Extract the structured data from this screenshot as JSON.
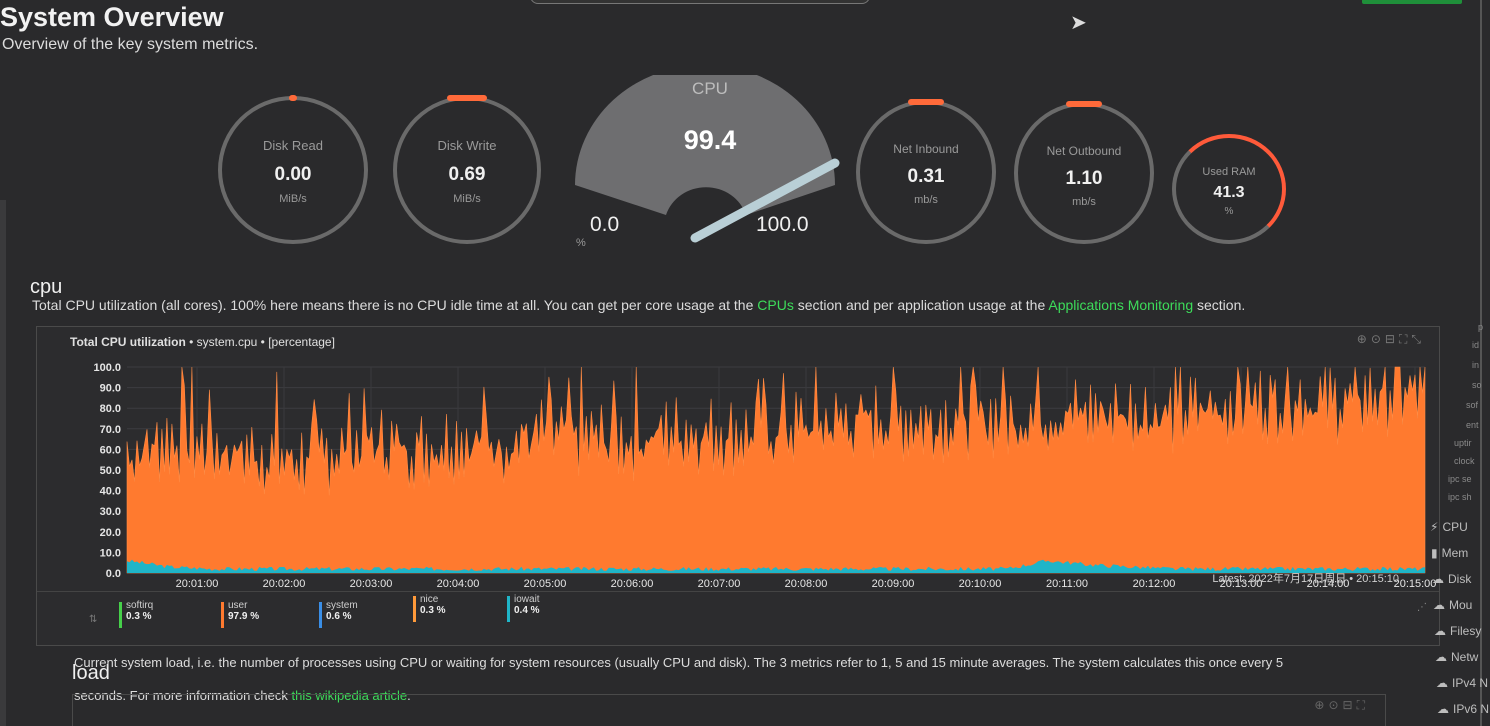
{
  "page": {
    "title": "System Overview",
    "subtitle": "Overview of the key system metrics."
  },
  "gauges": [
    {
      "label": "Disk Read",
      "value": "0.00",
      "unit": "MiB/s"
    },
    {
      "label": "Disk Write",
      "value": "0.69",
      "unit": "MiB/s"
    },
    {
      "label": "Net Inbound",
      "value": "0.31",
      "unit": "mb/s"
    },
    {
      "label": "Net Outbound",
      "value": "1.10",
      "unit": "mb/s"
    },
    {
      "label": "Used RAM",
      "value": "41.3",
      "unit": "%"
    }
  ],
  "cpu_gauge": {
    "label": "CPU",
    "value": "99.4",
    "min": "0.0",
    "max": "100.0",
    "unit": "%"
  },
  "cpu_section": {
    "title": "cpu",
    "desc_1": "Total CPU utilization (all cores). 100% here means there is no CPU idle time at all. You can get per core usage at the ",
    "link_cpus": "CPUs",
    "desc_2": " section and per application usage at the ",
    "link_apps": "Applications Monitoring",
    "desc_3": " section."
  },
  "chart": {
    "title_bold": "Total CPU utilization",
    "title_rest": " • system.cpu • [percentage]",
    "latest": "Latest: 2022年7月17日周日 • 20:15:10"
  },
  "chart_data": {
    "type": "area",
    "title": "Total CPU utilization",
    "ylim": [
      0,
      100
    ],
    "yticks": [
      "100.0",
      "90.0",
      "80.0",
      "70.0",
      "60.0",
      "50.0",
      "40.0",
      "30.0",
      "20.0",
      "10.0",
      "0.0"
    ],
    "xticks": [
      "20:01:00",
      "20:02:00",
      "20:03:00",
      "20:04:00",
      "20:05:00",
      "20:06:00",
      "20:07:00",
      "20:08:00",
      "20:09:00",
      "20:10:00",
      "20:11:00",
      "20:12:00",
      "20:13:00",
      "20:14:00",
      "20:15:00"
    ],
    "series": [
      {
        "name": "user",
        "color": "#ff7a2f",
        "profile": [
          55,
          62,
          58,
          55,
          52,
          56,
          60,
          58,
          62,
          60,
          65,
          63,
          62,
          66,
          65,
          64,
          68,
          70,
          72,
          70,
          73,
          72,
          74,
          75,
          76,
          74,
          78,
          80,
          82,
          80,
          84,
          86
        ]
      },
      {
        "name": "iowait",
        "color": "#1fb5c8",
        "profile": [
          6,
          3,
          2,
          2,
          2,
          2,
          2,
          2,
          2,
          2,
          2,
          2,
          2,
          2,
          2,
          2,
          2,
          2,
          2,
          2,
          2,
          2,
          6,
          4,
          3,
          2,
          2,
          2,
          2,
          2,
          2,
          2
        ]
      }
    ],
    "legend": [
      {
        "name": "softirq",
        "value": "0.3",
        "unit": "%",
        "color": "#46d04a"
      },
      {
        "name": "user",
        "value": "97.9",
        "unit": "%",
        "color": "#ff7a2f"
      },
      {
        "name": "system",
        "value": "0.6",
        "unit": "%",
        "color": "#3a8ee6"
      },
      {
        "name": "nice",
        "value": "0.3",
        "unit": "%",
        "color": "#ff9a3a"
      },
      {
        "name": "iowait",
        "value": "0.4",
        "unit": "%",
        "color": "#1fb5c8"
      }
    ]
  },
  "load_section": {
    "title": "load",
    "desc_1": "Current system load, i.e. the number of processes using CPU or waiting for system resources (usually CPU and disk). The 3 metrics refer to 1, 5 and 15 minute averages. The system calculates this once every 5",
    "desc_2": "seconds. For more information check ",
    "link": "this wikipedia article",
    "desc_3": "."
  },
  "right_menu": {
    "small_items": [
      "p",
      "id",
      "in",
      "so",
      "sof",
      "ent",
      "uptir",
      "clock",
      "ipc se",
      "ipc sh"
    ],
    "items": [
      "CPU",
      "Mem",
      "Disk",
      "Mou",
      "Filesy",
      "Netw",
      "IPv4 N",
      "IPv6 N"
    ]
  }
}
